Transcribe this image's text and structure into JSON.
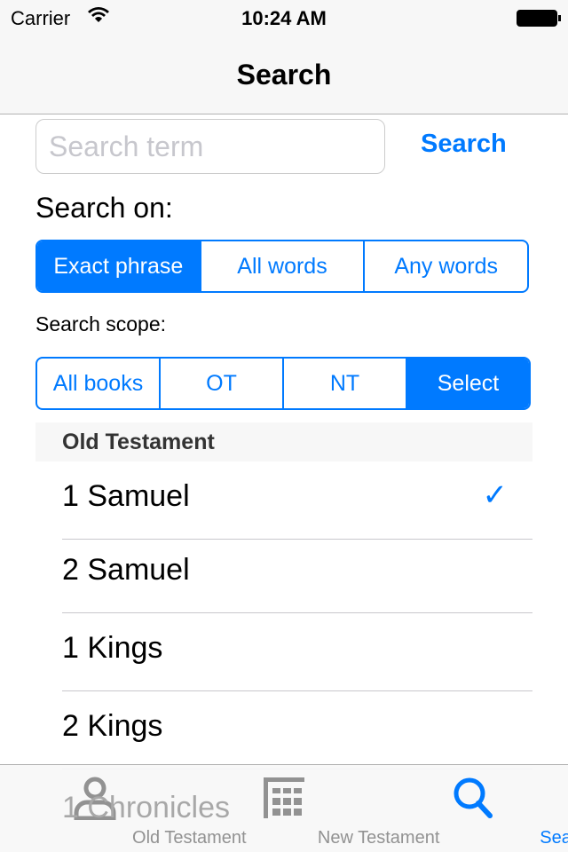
{
  "status": {
    "carrier": "Carrier",
    "time": "10:24 AM"
  },
  "nav": {
    "title": "Search"
  },
  "search": {
    "placeholder": "Search term",
    "value": "",
    "button": "Search"
  },
  "search_on": {
    "label": "Search on:",
    "options": [
      "Exact phrase",
      "All words",
      "Any words"
    ],
    "selected": "Exact phrase"
  },
  "scope": {
    "label": "Search scope:",
    "options": [
      "All books",
      "OT",
      "NT",
      "Select"
    ],
    "selected": "Select"
  },
  "list": {
    "section": "Old Testament",
    "items": [
      {
        "name": "1 Samuel",
        "checked": true
      },
      {
        "name": "2 Samuel",
        "checked": false
      },
      {
        "name": "1 Kings",
        "checked": false
      },
      {
        "name": "2 Kings",
        "checked": false
      },
      {
        "name": "1 Chronicles",
        "checked": false
      }
    ]
  },
  "tabbar": {
    "items": [
      {
        "label": "Old Testament",
        "icon": "person-icon"
      },
      {
        "label": "New Testament",
        "icon": "grid-icon"
      },
      {
        "label": "Search",
        "icon": "search-icon"
      }
    ],
    "selected": "Search"
  },
  "colors": {
    "accent": "#007aff"
  }
}
